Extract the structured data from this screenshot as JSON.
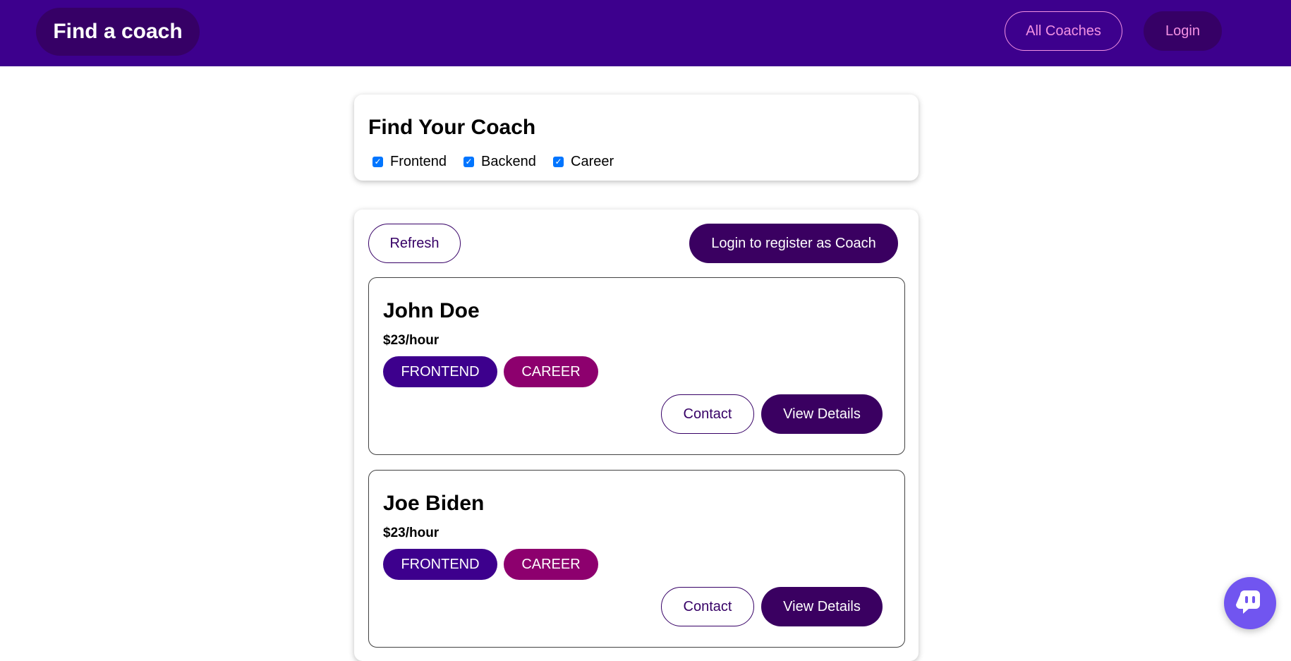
{
  "header": {
    "brand": "Find a coach",
    "nav": {
      "all_coaches": "All Coaches",
      "login": "Login"
    }
  },
  "filter": {
    "title": "Find Your Coach",
    "options": [
      {
        "label": "Frontend",
        "checked": true
      },
      {
        "label": "Backend",
        "checked": true
      },
      {
        "label": "Career",
        "checked": true
      }
    ]
  },
  "controls": {
    "refresh_label": "Refresh",
    "register_label": "Login to register as Coach"
  },
  "coaches": [
    {
      "name": "John Doe",
      "rate": "$23/hour",
      "areas": [
        "FRONTEND",
        "CAREER"
      ],
      "contact_label": "Contact",
      "details_label": "View Details"
    },
    {
      "name": "Joe Biden",
      "rate": "$23/hour",
      "areas": [
        "FRONTEND",
        "CAREER"
      ],
      "contact_label": "Contact",
      "details_label": "View Details"
    }
  ],
  "chat_widget": {
    "icon": "chat-icon"
  },
  "colors": {
    "header_bg": "#3d008d",
    "brand_bg": "#360066",
    "nav_text": "#f391e3",
    "badge_frontend": "#3d008d",
    "badge_career": "#8d006e",
    "chat_bg": "#7155f0"
  }
}
